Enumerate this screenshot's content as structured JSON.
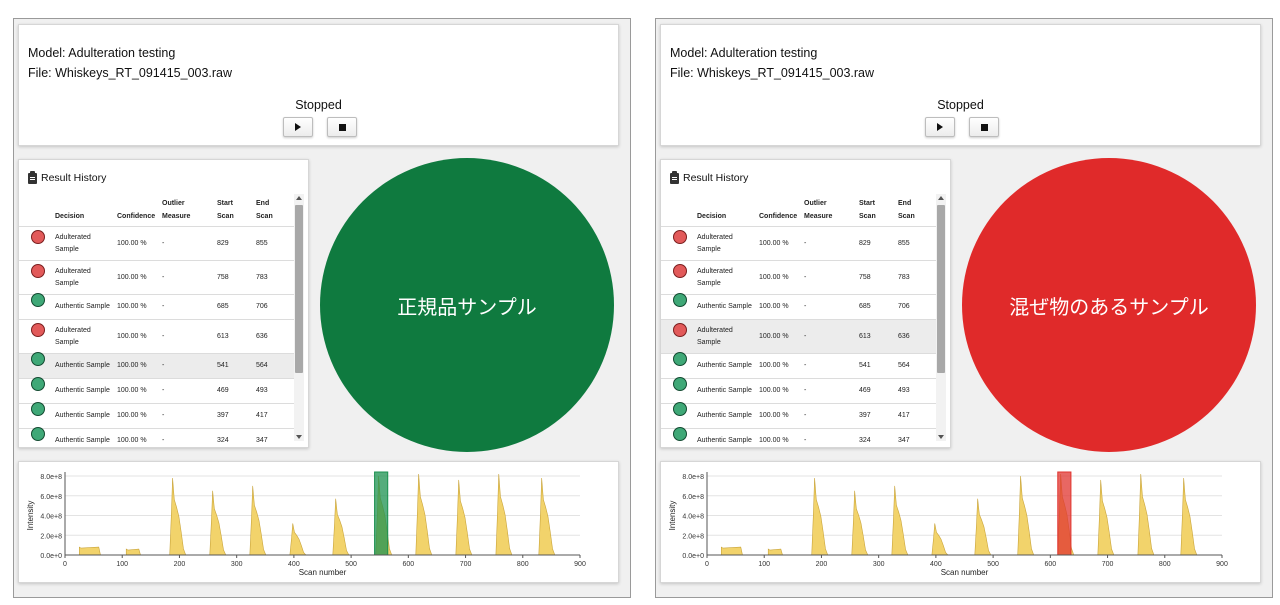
{
  "panels": [
    {
      "model_label": "Model: Adulteration testing",
      "file_label": "File: Whiskeys_RT_091415_003.raw",
      "status": "Stopped",
      "controls": {
        "play_icon": "play-icon",
        "stop_icon": "stop-icon"
      },
      "history": {
        "title": "Result History",
        "title_icon": "clipboard-icon",
        "columns": {
          "decision": "Decision",
          "confidence": "Confidence",
          "outlier_1": "Outlier",
          "outlier_2": "Measure",
          "start_1": "Start",
          "start_2": "Scan",
          "end_1": "End",
          "end_2": "Scan"
        },
        "rows": [
          {
            "status": "red",
            "decision_1": "Adulterated",
            "decision_2": "Sample",
            "confidence": "100.00 %",
            "outlier": "-",
            "start": "829",
            "end": "855"
          },
          {
            "status": "red",
            "decision_1": "Adulterated",
            "decision_2": "Sample",
            "confidence": "100.00 %",
            "outlier": "-",
            "start": "758",
            "end": "783"
          },
          {
            "status": "green",
            "decision_1": "Authentic Sample",
            "decision_2": "",
            "confidence": "100.00 %",
            "outlier": "-",
            "start": "685",
            "end": "706"
          },
          {
            "status": "red",
            "decision_1": "Adulterated",
            "decision_2": "Sample",
            "confidence": "100.00 %",
            "outlier": "-",
            "start": "613",
            "end": "636"
          },
          {
            "status": "green",
            "decision_1": "Authentic Sample",
            "decision_2": "",
            "confidence": "100.00 %",
            "outlier": "-",
            "start": "541",
            "end": "564"
          },
          {
            "status": "green",
            "decision_1": "Authentic Sample",
            "decision_2": "",
            "confidence": "100.00 %",
            "outlier": "-",
            "start": "469",
            "end": "493"
          },
          {
            "status": "green",
            "decision_1": "Authentic Sample",
            "decision_2": "",
            "confidence": "100.00 %",
            "outlier": "-",
            "start": "397",
            "end": "417"
          },
          {
            "status": "green",
            "decision_1": "Authentic Sample",
            "decision_2": "",
            "confidence": "100.00 %",
            "outlier": "-",
            "start": "324",
            "end": "347"
          }
        ]
      },
      "verdict": {
        "text": "正規品サンプル",
        "color": "#0f7a3f"
      },
      "chart_data": {
        "type": "area",
        "xlabel": "Scan number",
        "ylabel": "Intensity",
        "xlim": [
          0,
          900
        ],
        "ylim": [
          0,
          80000000
        ],
        "x_ticks": [
          0,
          100,
          200,
          300,
          400,
          500,
          600,
          700,
          800,
          900
        ],
        "y_ticks": [
          0,
          20000000,
          40000000,
          60000000,
          80000000
        ],
        "y_tick_labels": [
          "0.0e+0",
          "2.0e+8",
          "4.0e+8",
          "6.0e+8",
          "8.0e+8"
        ],
        "series_color": "#f2d36b",
        "peaks": [
          {
            "start": 185,
            "height": 78000000
          },
          {
            "start": 255,
            "height": 65000000
          },
          {
            "start": 325,
            "height": 70000000
          },
          {
            "start": 395,
            "height": 32000000
          },
          {
            "start": 470,
            "height": 57000000
          },
          {
            "start": 545,
            "height": 80000000
          },
          {
            "start": 615,
            "height": 82000000
          },
          {
            "start": 685,
            "height": 76000000
          },
          {
            "start": 755,
            "height": 82000000
          },
          {
            "start": 830,
            "height": 78000000
          }
        ],
        "plateaus": [
          {
            "start": 25,
            "end": 62,
            "height": 8000000
          },
          {
            "start": 107,
            "end": 132,
            "height": 6000000
          }
        ],
        "highlight": {
          "start": 541,
          "end": 564,
          "color": "#1c9150"
        }
      }
    },
    {
      "model_label": "Model: Adulteration testing",
      "file_label": "File: Whiskeys_RT_091415_003.raw",
      "status": "Stopped",
      "controls": {
        "play_icon": "play-icon",
        "stop_icon": "stop-icon"
      },
      "history": {
        "title": "Result History",
        "title_icon": "clipboard-icon",
        "columns": {
          "decision": "Decision",
          "confidence": "Confidence",
          "outlier_1": "Outlier",
          "outlier_2": "Measure",
          "start_1": "Start",
          "start_2": "Scan",
          "end_1": "End",
          "end_2": "Scan"
        },
        "rows": [
          {
            "status": "red",
            "decision_1": "Adulterated",
            "decision_2": "Sample",
            "confidence": "100.00 %",
            "outlier": "-",
            "start": "829",
            "end": "855"
          },
          {
            "status": "red",
            "decision_1": "Adulterated",
            "decision_2": "Sample",
            "confidence": "100.00 %",
            "outlier": "-",
            "start": "758",
            "end": "783"
          },
          {
            "status": "green",
            "decision_1": "Authentic Sample",
            "decision_2": "",
            "confidence": "100.00 %",
            "outlier": "-",
            "start": "685",
            "end": "706"
          },
          {
            "status": "red",
            "decision_1": "Adulterated",
            "decision_2": "Sample",
            "confidence": "100.00 %",
            "outlier": "-",
            "start": "613",
            "end": "636"
          },
          {
            "status": "green",
            "decision_1": "Authentic Sample",
            "decision_2": "",
            "confidence": "100.00 %",
            "outlier": "-",
            "start": "541",
            "end": "564"
          },
          {
            "status": "green",
            "decision_1": "Authentic Sample",
            "decision_2": "",
            "confidence": "100.00 %",
            "outlier": "-",
            "start": "469",
            "end": "493"
          },
          {
            "status": "green",
            "decision_1": "Authentic Sample",
            "decision_2": "",
            "confidence": "100.00 %",
            "outlier": "-",
            "start": "397",
            "end": "417"
          },
          {
            "status": "green",
            "decision_1": "Authentic Sample",
            "decision_2": "",
            "confidence": "100.00 %",
            "outlier": "-",
            "start": "324",
            "end": "347"
          }
        ]
      },
      "verdict": {
        "text": "混ぜ物のあるサンプル",
        "color": "#e02a2a"
      },
      "chart_data": {
        "type": "area",
        "xlabel": "Scan number",
        "ylabel": "Intensity",
        "xlim": [
          0,
          900
        ],
        "ylim": [
          0,
          80000000
        ],
        "x_ticks": [
          0,
          100,
          200,
          300,
          400,
          500,
          600,
          700,
          800,
          900
        ],
        "y_ticks": [
          0,
          20000000,
          40000000,
          60000000,
          80000000
        ],
        "y_tick_labels": [
          "0.0e+0",
          "2.0e+8",
          "4.0e+8",
          "6.0e+8",
          "8.0e+8"
        ],
        "series_color": "#f2d36b",
        "peaks": [
          {
            "start": 185,
            "height": 78000000
          },
          {
            "start": 255,
            "height": 65000000
          },
          {
            "start": 325,
            "height": 70000000
          },
          {
            "start": 395,
            "height": 32000000
          },
          {
            "start": 470,
            "height": 57000000
          },
          {
            "start": 545,
            "height": 80000000
          },
          {
            "start": 615,
            "height": 82000000
          },
          {
            "start": 685,
            "height": 76000000
          },
          {
            "start": 755,
            "height": 82000000
          },
          {
            "start": 830,
            "height": 78000000
          }
        ],
        "plateaus": [
          {
            "start": 25,
            "end": 62,
            "height": 8000000
          },
          {
            "start": 107,
            "end": 132,
            "height": 6000000
          }
        ],
        "highlight": {
          "start": 613,
          "end": 636,
          "color": "#e0342f"
        }
      }
    }
  ]
}
